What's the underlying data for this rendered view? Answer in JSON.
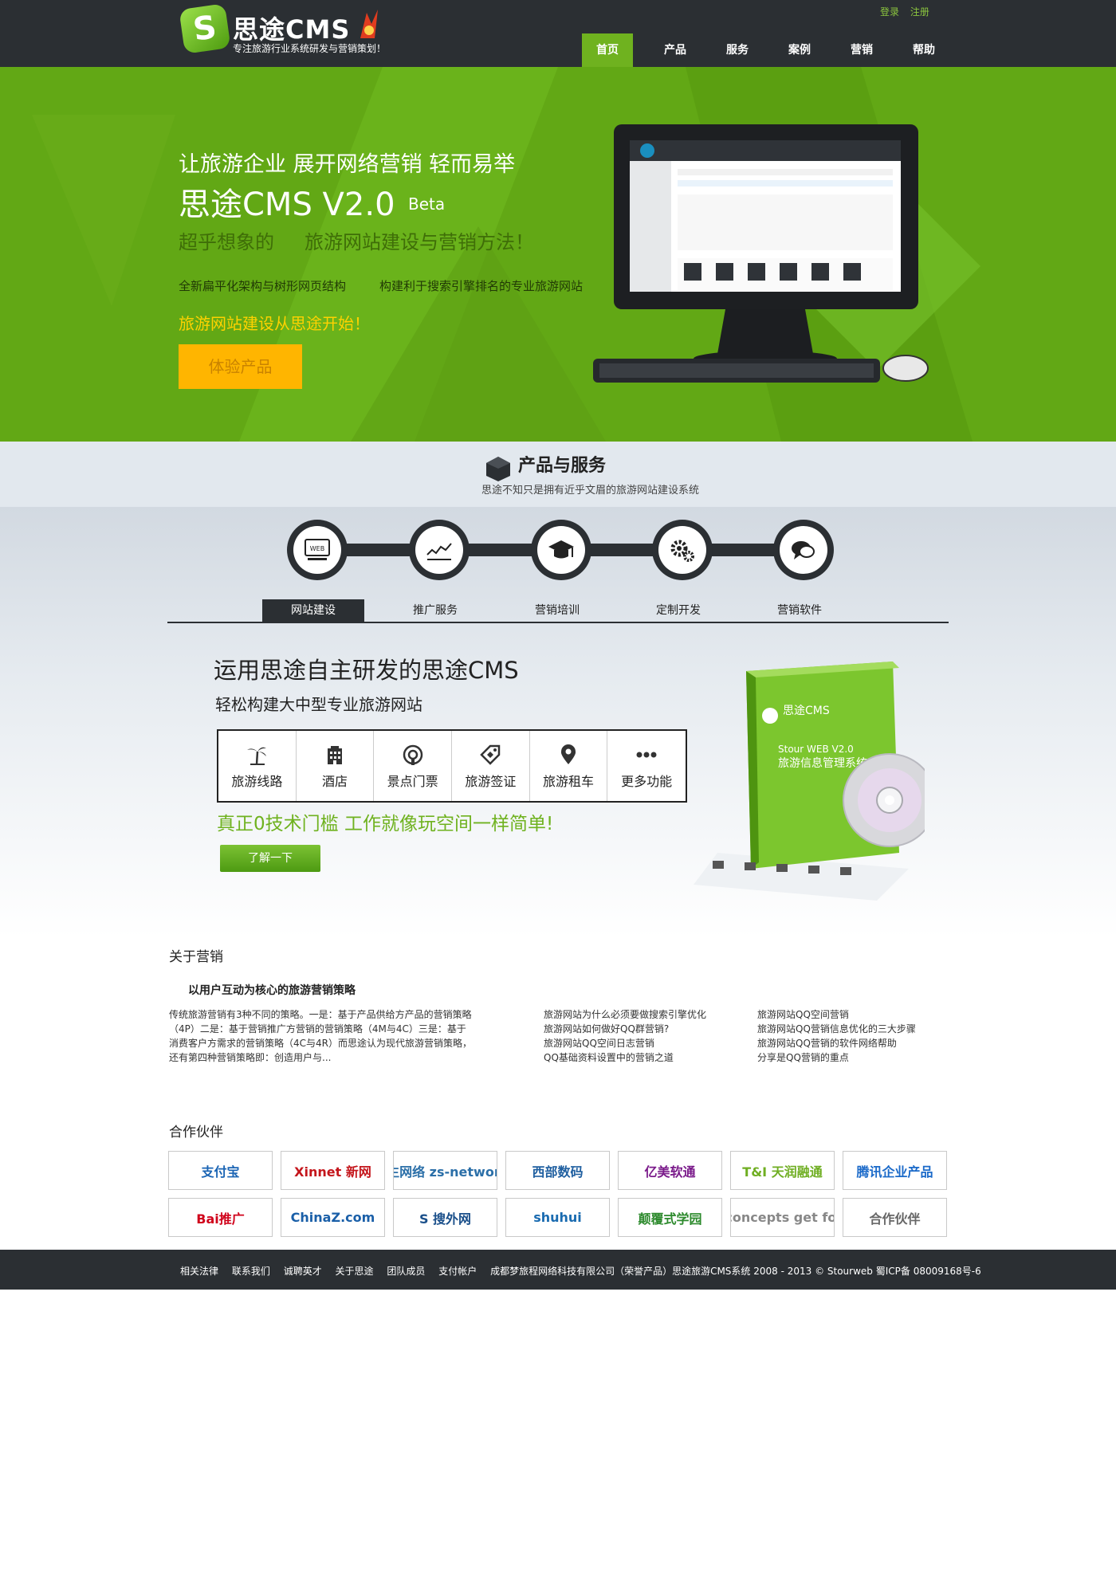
{
  "header": {
    "logo_name": "思途CMS",
    "logo_tagline": "专注旅游行业系统研发与营销策划！",
    "login": "登录",
    "register": "注册",
    "nav": [
      "首页",
      "产品",
      "服务",
      "案例",
      "营销",
      "帮助"
    ],
    "active_nav": "首页"
  },
  "hero": {
    "line1": "让旅游企业 展开网络营销 轻而易举",
    "title": "思途CMS V2.0",
    "beta": "Beta",
    "sub_a": "超乎想象的",
    "sub_b": "旅游网站建设与营销方法！",
    "feature_a": "全新扁平化架构与树形网页结构",
    "feature_b": "构建利于搜索引擎排名的专业旅游网站",
    "cta_text": "旅游网站建设从思途开始！",
    "button": "体验产品"
  },
  "products": {
    "title": "产品与服务",
    "subtitle": "思途不知只是拥有近乎文眉的旅游网站建设系统",
    "tabs": [
      "网站建设",
      "推广服务",
      "营销培训",
      "定制开发",
      "营销软件"
    ],
    "active_tab": "网站建设",
    "step_icons": [
      "web-icon",
      "chart-icon",
      "graduation-cap-icon",
      "gears-icon",
      "chat-icon"
    ],
    "cms_title": "运用思途自主研发的思途CMS",
    "cms_subtitle": "轻松构建大中型专业旅游网站",
    "features": [
      {
        "label": "旅游线路",
        "icon": "palm-tree-icon"
      },
      {
        "label": "酒店",
        "icon": "hotel-icon"
      },
      {
        "label": "景点门票",
        "icon": "ticket-icon"
      },
      {
        "label": "旅游签证",
        "icon": "visa-tag-icon"
      },
      {
        "label": "旅游租车",
        "icon": "map-pin-icon"
      },
      {
        "label": "更多功能",
        "icon": "more-dots-icon"
      }
    ],
    "slogan": "真正0技术门槛  工作就像玩空间一样简单!",
    "learn_more": "了解一下",
    "box_text": [
      "思途CMS",
      "Stour WEB V2.0",
      "旅游信息管理系统"
    ]
  },
  "marketing": {
    "title": "关于营销",
    "subtitle": "以用户互动为核心的旅游营销策略",
    "body": "传统旅游营销有3种不同的策略。一是：基于产品供给方产品的营销策略（4P）二是：基于营销推广方营销的营销策略（4M与4C）三是：基于消费客户方需求的营销策略（4C与4R）而思途认为现代旅游营销策略，还有第四种营销策略即：创造用户与...",
    "links_col1": [
      "旅游网站为什么必须要做搜索引擎优化",
      "旅游网站如何做好QQ群营销?",
      "旅游网站QQ空间日志营销",
      "QQ基础资料设置中的营销之道"
    ],
    "links_col2": [
      "旅游网站QQ空间营销",
      "旅游网站QQ营销信息优化的三大步骤",
      "旅游网站QQ营销的软件网络帮助",
      "分享是QQ营销的重点"
    ]
  },
  "partners": {
    "title": "合作伙伴",
    "row1": [
      {
        "name": "支付宝",
        "color": "#1a64b4"
      },
      {
        "name": "Xinnet 新网",
        "color": "#c4161c"
      },
      {
        "name": "众生网络 zs-networks",
        "color": "#2b6fa8"
      },
      {
        "name": "西部数码",
        "color": "#1f5fa0"
      },
      {
        "name": "亿美软通",
        "color": "#7a1a8a"
      },
      {
        "name": "T&I 天润融通",
        "color": "#6fae22"
      },
      {
        "name": "腾讯企业产品",
        "color": "#1b6ac9"
      }
    ],
    "row2": [
      {
        "name": "Bai推广",
        "color": "#d0021b"
      },
      {
        "name": "ChinaZ.com",
        "color": "#1a5fa8"
      },
      {
        "name": "S 搜外网",
        "color": "#1a4f8a"
      },
      {
        "name": "shuhui",
        "color": "#1a6bb0"
      },
      {
        "name": "颠覆式学园",
        "color": "#2d8a2d"
      },
      {
        "name": "netconcepts get found",
        "color": "#888888"
      },
      {
        "name": "合作伙伴",
        "color": "#666666"
      }
    ]
  },
  "footer": {
    "links": [
      "相关法律",
      "联系我们",
      "诚聘英才",
      "关于思途",
      "团队成员",
      "支付帐户"
    ],
    "copyright": "成都梦旅程网络科技有限公司（荣誉产品）思途旅游CMS系统 2008 - 2013 © Stourweb 蜀ICP备 08009168号-6"
  },
  "colors": {
    "brand_green": "#6fb21f",
    "dark": "#2b2f33",
    "cta_yellow": "#ffb500"
  }
}
